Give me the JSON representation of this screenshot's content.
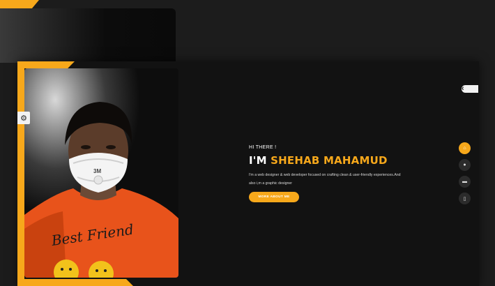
{
  "intro": {
    "greeting": "HI THERE !",
    "headline_prefix": "I'M ",
    "name": "SHEHAB MAHAMUD",
    "bio": "I'm a web designer & web developer focused on crafting clean & user-friendly experiences.And also i,m a graphic designer",
    "cta_label": "MORE ABOUT ME"
  },
  "photo": {
    "mask_text": "3M",
    "shirt_text": "Best Friend",
    "alt": "Portrait of Shehab Mahamud"
  },
  "icons": {
    "settings": "gear-icon",
    "nav_home": "home-icon",
    "nav_about": "user-icon",
    "nav_portfolio": "briefcase-icon",
    "nav_contact": "phone-icon"
  },
  "colors": {
    "accent": "#f7a81b",
    "panel": "#121212",
    "background": "#1c1c1c"
  }
}
